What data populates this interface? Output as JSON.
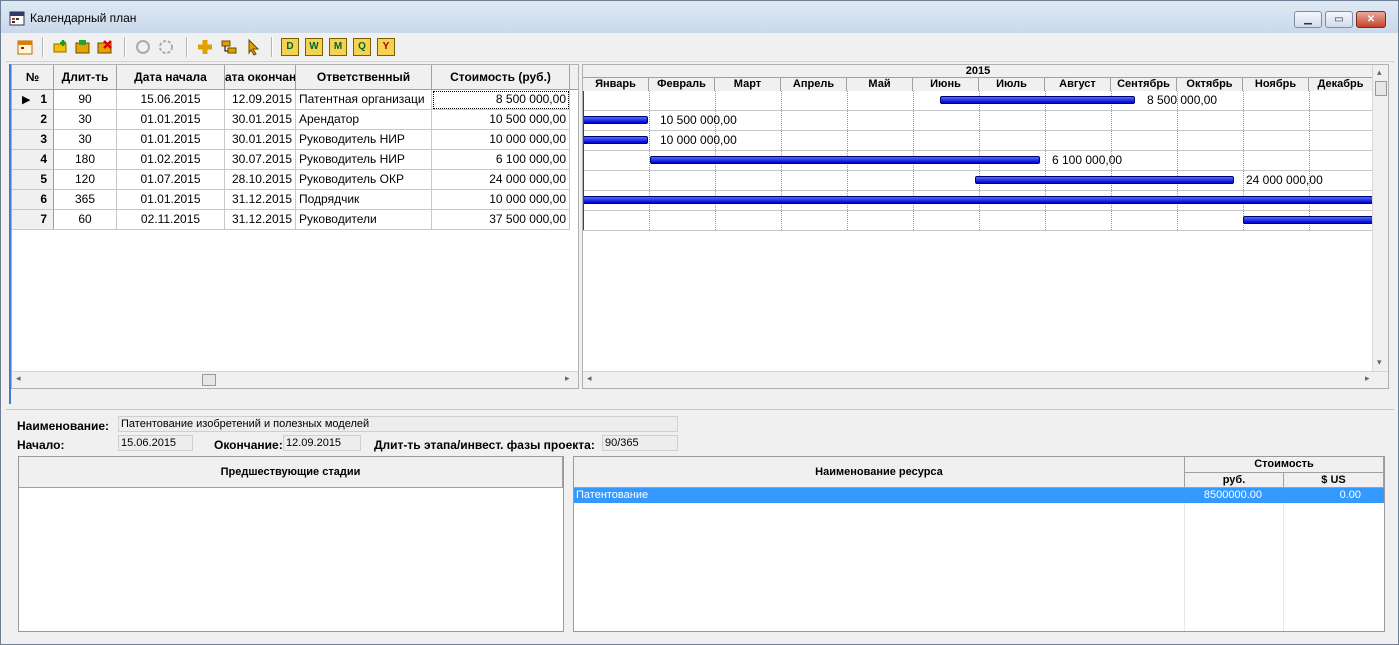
{
  "window": {
    "title": "Календарный план"
  },
  "colors": {
    "bar": "#0000cc",
    "selection": "#3399ff"
  },
  "toolbar": {
    "icons": [
      "calendar-icon",
      "add-task-icon",
      "add-resource-icon",
      "delete-icon",
      "group-icon",
      "ungroup-icon",
      "add-icon",
      "link-icon",
      "pointer-icon",
      "day-view-icon",
      "week-view-icon",
      "month-view-icon",
      "quarter-view-icon",
      "year-view-icon"
    ],
    "d": "D",
    "w": "W",
    "m": "M",
    "q": "Q",
    "y": "Y"
  },
  "grid": {
    "headers": {
      "num": "№",
      "duration": "Длит-ть",
      "start": "Дата начала",
      "end": "ата окончан",
      "owner": "Ответственный",
      "cost": "Стоимость (руб.)"
    },
    "rows": [
      {
        "num": "1",
        "duration": "90",
        "start": "15.06.2015",
        "end": "12.09.2015",
        "owner": "Патентная организаци",
        "cost": "8 500 000,00"
      },
      {
        "num": "2",
        "duration": "30",
        "start": "01.01.2015",
        "end": "30.01.2015",
        "owner": "Арендатор",
        "cost": "10 500 000,00"
      },
      {
        "num": "3",
        "duration": "30",
        "start": "01.01.2015",
        "end": "30.01.2015",
        "owner": "Руководитель НИР",
        "cost": "10 000 000,00"
      },
      {
        "num": "4",
        "duration": "180",
        "start": "01.02.2015",
        "end": "30.07.2015",
        "owner": "Руководитель НИР",
        "cost": "6 100 000,00"
      },
      {
        "num": "5",
        "duration": "120",
        "start": "01.07.2015",
        "end": "28.10.2015",
        "owner": "Руководитель ОКР",
        "cost": "24 000 000,00"
      },
      {
        "num": "6",
        "duration": "365",
        "start": "01.01.2015",
        "end": "31.12.2015",
        "owner": "Подрядчик",
        "cost": "10 000 000,00"
      },
      {
        "num": "7",
        "duration": "60",
        "start": "02.11.2015",
        "end": "31.12.2015",
        "owner": "Руководители",
        "cost": "37 500 000,00"
      }
    ]
  },
  "gantt": {
    "year": "2015",
    "months": [
      "Январь",
      "Февраль",
      "Март",
      "Апрель",
      "Май",
      "Июнь",
      "Июль",
      "Август",
      "Сентябрь",
      "Октябрь",
      "Ноябрь",
      "Декабрь"
    ],
    "bars": [
      {
        "label": "8 500 000,00"
      },
      {
        "label": "10 500 000,00"
      },
      {
        "label": "10 000 000,00"
      },
      {
        "label": "6 100 000,00"
      },
      {
        "label": "24 000 000,00"
      },
      {
        "label": ""
      },
      {
        "label": ""
      }
    ]
  },
  "details": {
    "name_label": "Наименование:",
    "name_value": "Патентование  изобретений и полезных моделей",
    "start_label": "Начало:",
    "start_value": "15.06.2015",
    "end_label": "Окончание:",
    "end_value": "12.09.2015",
    "phase_label": "Длит-ть этапа/инвест. фазы проекта:",
    "phase_value": "90/365"
  },
  "predecessors": {
    "header": "Предшествующие стадии"
  },
  "resources": {
    "header_name": "Наименование ресурса",
    "header_cost": "Стоимость",
    "header_rub": "руб.",
    "header_usd": "$ US",
    "rows": [
      {
        "name": "Патентование",
        "rub": "8500000.00",
        "usd": "0.00"
      }
    ]
  }
}
